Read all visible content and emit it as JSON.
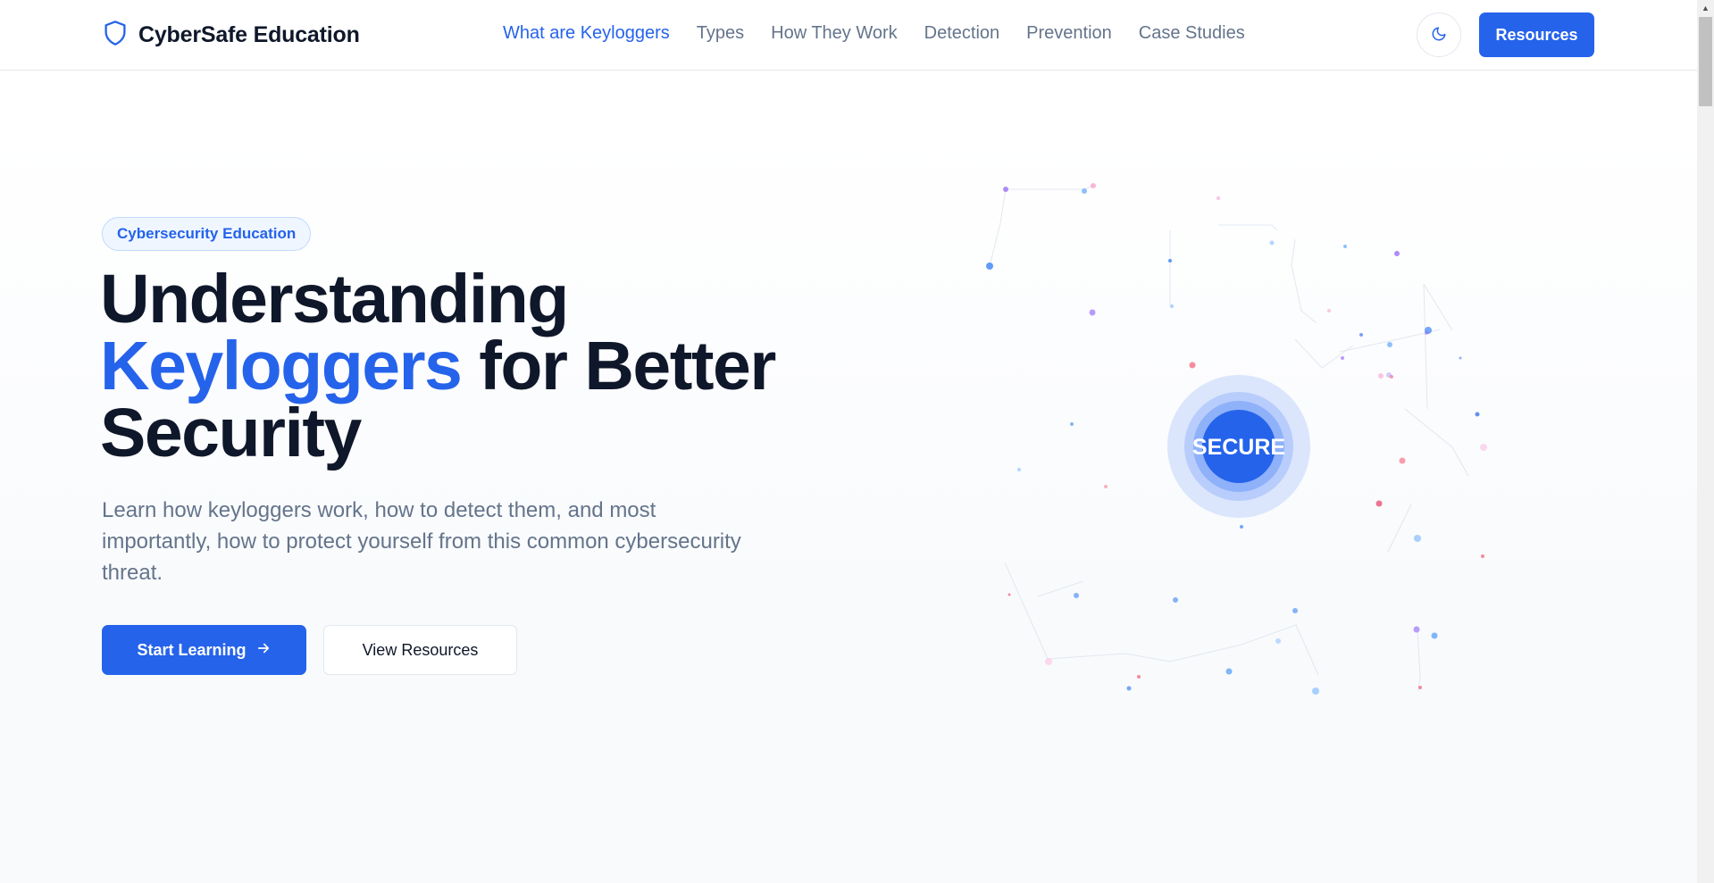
{
  "brand": {
    "name": "CyberSafe Education",
    "icon": "shield-icon"
  },
  "nav": {
    "items": [
      {
        "label": "What are Keyloggers",
        "active": true
      },
      {
        "label": "Types",
        "active": false
      },
      {
        "label": "How They Work",
        "active": false
      },
      {
        "label": "Detection",
        "active": false
      },
      {
        "label": "Prevention",
        "active": false
      },
      {
        "label": "Case Studies",
        "active": false
      }
    ],
    "theme_toggle_icon": "moon-icon",
    "resources_label": "Resources"
  },
  "hero": {
    "badge": "Cybersecurity Education",
    "title_part1": "Understanding",
    "title_highlight": "Keyloggers",
    "title_part2": "for Better Security",
    "subtitle": "Learn how keyloggers work, how to detect them, and most importantly, how to protect yourself from this common cybersecurity threat.",
    "primary_button": "Start Learning",
    "primary_button_icon": "arrow-right-icon",
    "secondary_button": "View Resources"
  },
  "visual": {
    "center_label": "SECURE"
  },
  "colors": {
    "accent": "#2563eb",
    "text_dark": "#0f172a",
    "text_muted": "#64748b"
  }
}
